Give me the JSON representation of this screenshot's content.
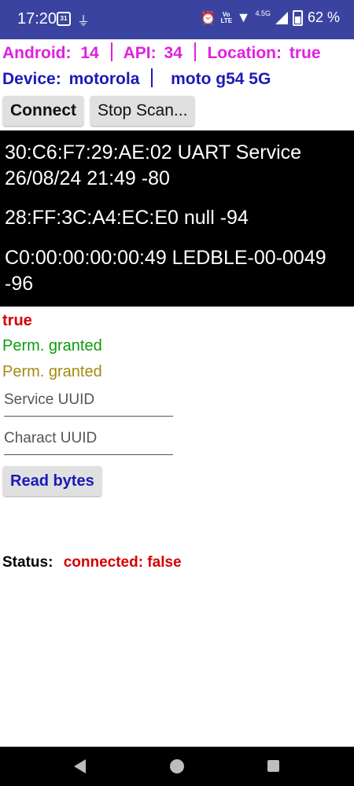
{
  "status_bar": {
    "time": "17:20",
    "calendar_day": "31",
    "network": "4.5G",
    "volte": "Vo LTE",
    "battery": "62 %"
  },
  "info": {
    "android_label": "Android:",
    "android_value": "14",
    "api_label": "API:",
    "api_value": "34",
    "location_label": "Location:",
    "location_value": "true",
    "device_label": "Device:",
    "device_value": "motorola",
    "model_value": "moto g54 5G"
  },
  "buttons": {
    "connect": "Connect",
    "stop_scan": "Stop Scan...",
    "read_bytes": "Read bytes"
  },
  "devices": [
    "30:C6:F7:29:AE:02 UART Service 26/08/24 21:49 -80",
    "28:FF:3C:A4:EC:E0 null -94",
    "C0:00:00:00:00:49 LEDBLE-00-0049 -96"
  ],
  "flags": {
    "true_text": "true",
    "perm1": "Perm. granted",
    "perm2": "Perm. granted"
  },
  "inputs": {
    "service_uuid_placeholder": "Service UUID",
    "charact_uuid_placeholder": "Charact UUID"
  },
  "status": {
    "label": "Status:",
    "value": "connected: false"
  },
  "colors": {
    "status_bar": "#3a44a0",
    "magenta": "#e020e0",
    "blue": "#1a1ab8",
    "red": "#d40000",
    "green": "#0c9c0c",
    "olive": "#a48a10"
  },
  "icons": {
    "usb": "usb-debug-icon",
    "alarm": "alarm-icon",
    "wifi": "wifi-icon",
    "signal": "signal-icon",
    "battery": "battery-icon"
  }
}
